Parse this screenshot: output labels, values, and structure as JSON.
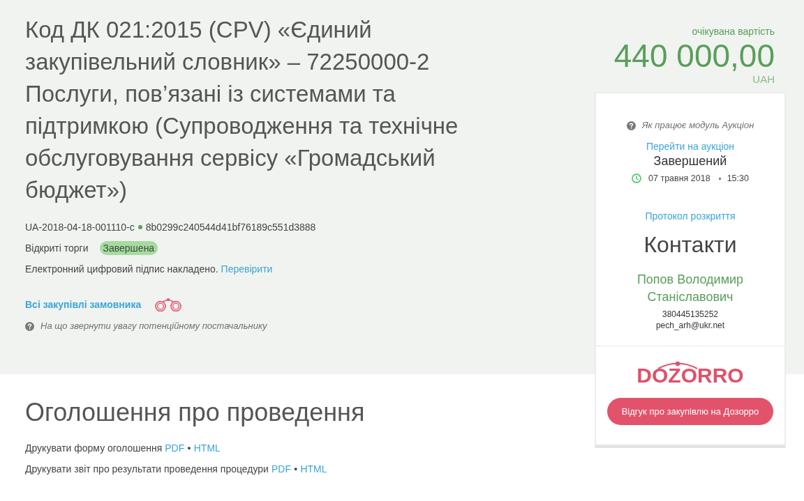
{
  "header": {
    "title": "Код ДК 021:2015 (CPV) «Єдиний закупівельний словник» – 72250000-2 Послуги, пов’язані із системами та підтримкою (Супроводження та технічне обслуговування сервісу «Громадський бюджет»)",
    "tender_id": "UA-2018-04-18-001110-c",
    "hash": "8b0299c240544d41bf76189c551d3888",
    "procedure_type": "Відкриті торги",
    "status": "Завершена",
    "signature_text": "Електронний цифровий підпис накладено.",
    "signature_link": "Перевірити",
    "buyer_link": "Всі закупівлі замовника",
    "hint": "На що звернути увагу потенційному постачальнику"
  },
  "budget": {
    "label": "очікувана вартість",
    "amount": "440 000,00",
    "currency": "UAH"
  },
  "auction": {
    "help": "Як працює модуль Аукціон",
    "link": "Перейти на аукціон",
    "status": "Завершений",
    "date": "07 травня 2018",
    "time": "15:30",
    "protocol_link": "Протокол розкриття"
  },
  "contacts": {
    "title": "Контакти",
    "name": "Попов Володимир Станіславович",
    "phone": "380445135252",
    "email": "pech_arh@ukr.net"
  },
  "dozorro": {
    "logo": "DOZORRO",
    "button": "Відгук про закупівлю на Дозорро"
  },
  "announcement": {
    "title": "Оголошення про проведення",
    "print_rows": [
      {
        "label": "Друкувати форму оголошення",
        "pdf": "PDF",
        "separator": "●",
        "html": "HTML"
      },
      {
        "label": "Друкувати звіт про результати проведення процедури",
        "pdf": "PDF",
        "separator": "●",
        "html": "HTML"
      }
    ]
  }
}
